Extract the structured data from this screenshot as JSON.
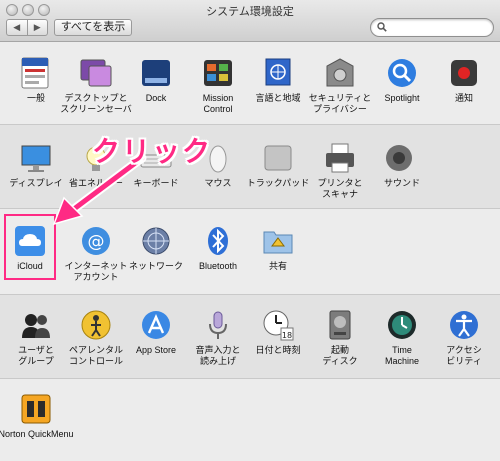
{
  "window": {
    "title": "システム環境設定",
    "show_all": "すべてを表示",
    "nav_back": "◀",
    "nav_forward": "▶",
    "search_placeholder": ""
  },
  "callout": {
    "text": "クリック"
  },
  "sections": [
    {
      "items": [
        {
          "label": "一般",
          "icon": "general-icon"
        },
        {
          "label": "デスクトップと\nスクリーンセーバ",
          "icon": "desktop-icon"
        },
        {
          "label": "Dock",
          "icon": "dock-icon"
        },
        {
          "label": "Mission\nControl",
          "icon": "mission-control-icon"
        },
        {
          "label": "言語と地域",
          "icon": "language-icon"
        },
        {
          "label": "セキュリティと\nプライバシー",
          "icon": "security-icon"
        },
        {
          "label": "Spotlight",
          "icon": "spotlight-icon"
        },
        {
          "label": "通知",
          "icon": "notifications-icon"
        }
      ]
    },
    {
      "items": [
        {
          "label": "ディスプレイ",
          "icon": "display-icon"
        },
        {
          "label": "省エネルギー",
          "icon": "energy-icon"
        },
        {
          "label": "キーボード",
          "icon": "keyboard-icon"
        },
        {
          "label": "マウス",
          "icon": "mouse-icon"
        },
        {
          "label": "トラックパッド",
          "icon": "trackpad-icon"
        },
        {
          "label": "プリンタと\nスキャナ",
          "icon": "printer-icon"
        },
        {
          "label": "サウンド",
          "icon": "sound-icon"
        }
      ]
    },
    {
      "items": [
        {
          "label": "iCloud",
          "icon": "icloud-icon"
        },
        {
          "label": "インターネット\nアカウント",
          "icon": "internet-accounts-icon"
        },
        {
          "label": "ネットワーク",
          "icon": "network-icon"
        },
        {
          "label": "Bluetooth",
          "icon": "bluetooth-icon"
        },
        {
          "label": "共有",
          "icon": "sharing-icon"
        }
      ]
    },
    {
      "items": [
        {
          "label": "ユーザと\nグループ",
          "icon": "users-icon"
        },
        {
          "label": "ペアレンタル\nコントロール",
          "icon": "parental-icon"
        },
        {
          "label": "App Store",
          "icon": "app-store-icon"
        },
        {
          "label": "音声入力と\n読み上げ",
          "icon": "dictation-icon"
        },
        {
          "label": "日付と時刻",
          "icon": "date-time-icon"
        },
        {
          "label": "起動\nディスク",
          "icon": "startup-disk-icon"
        },
        {
          "label": "Time\nMachine",
          "icon": "time-machine-icon"
        },
        {
          "label": "アクセシ\nビリティ",
          "icon": "accessibility-icon"
        }
      ]
    },
    {
      "items": [
        {
          "label": "Norton QuickMenu",
          "icon": "norton-icon"
        }
      ]
    }
  ]
}
